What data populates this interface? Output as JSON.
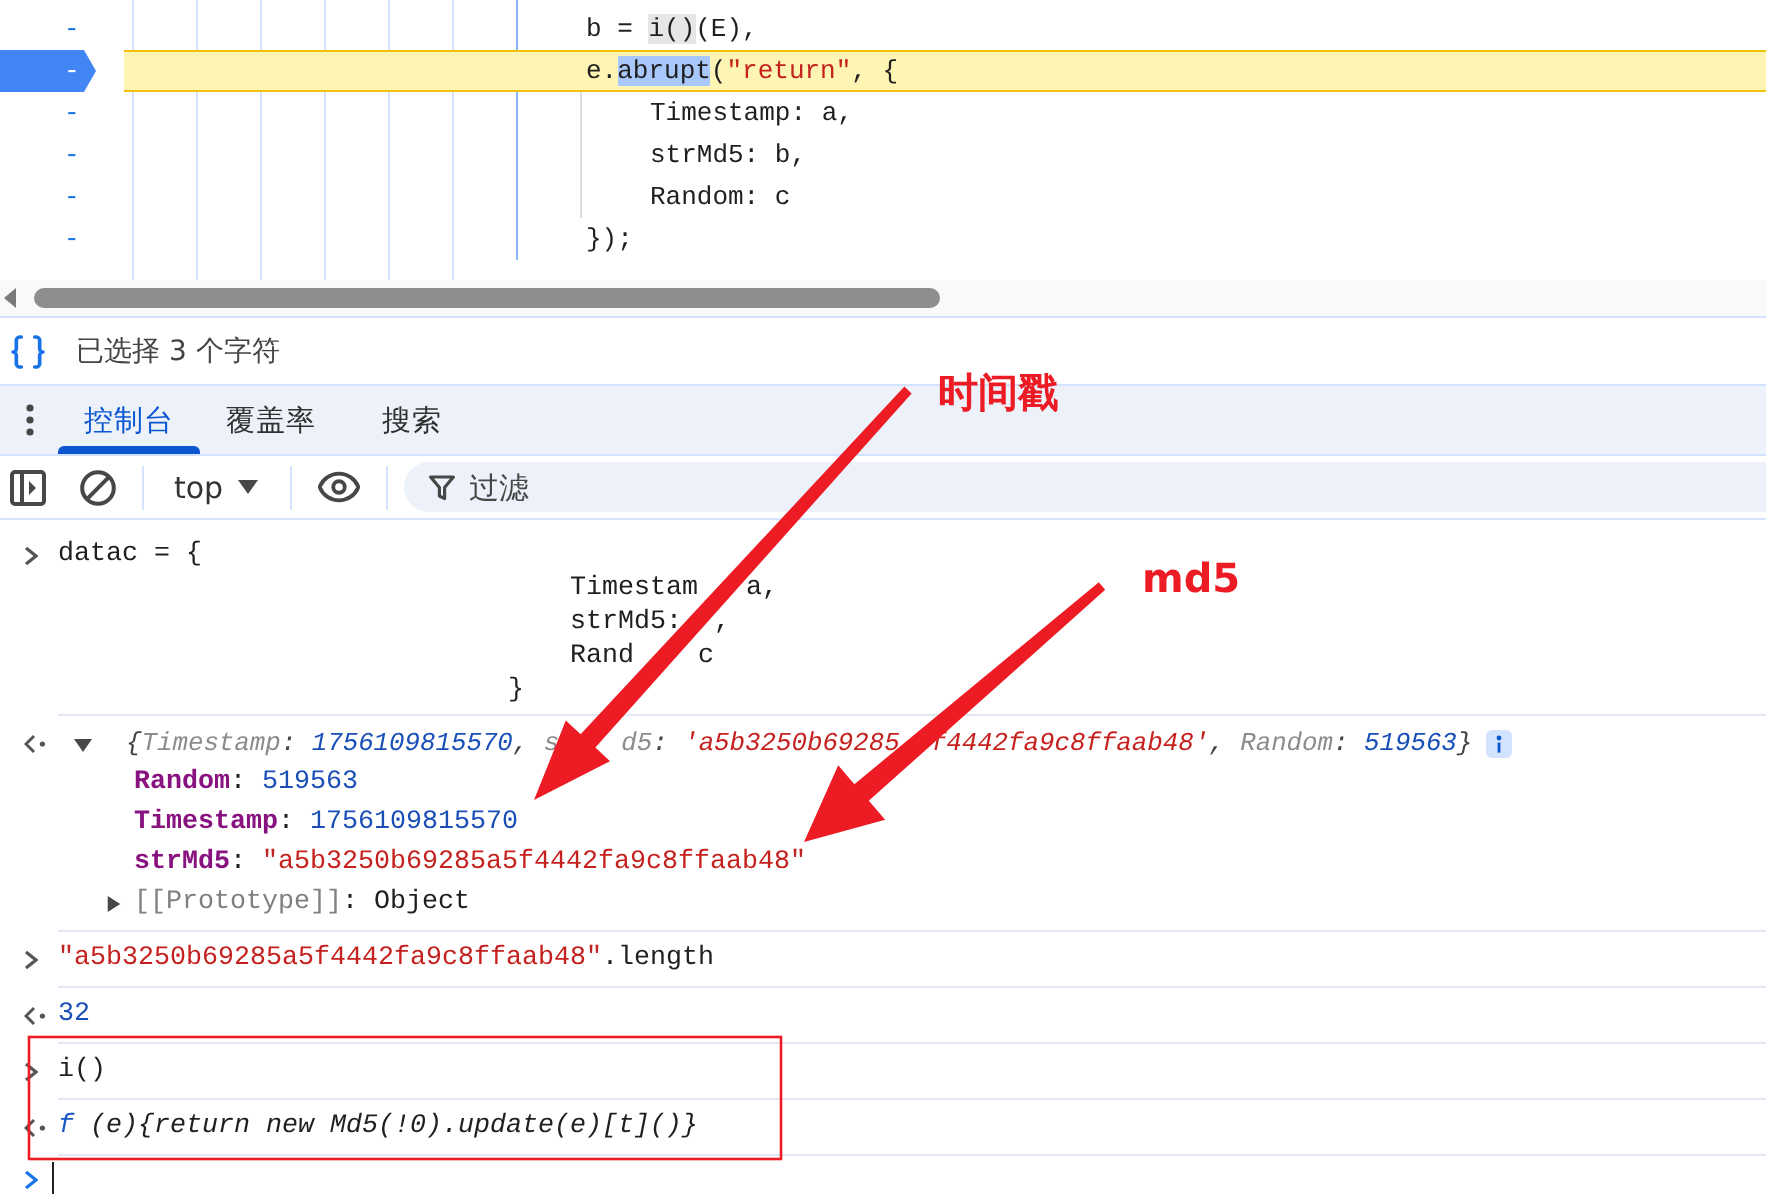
{
  "editor": {
    "lines": [
      {
        "marker": "-",
        "current": false,
        "tokens": [
          {
            "kind": "plain",
            "text": "b = "
          },
          {
            "kind": "match",
            "text": "i()"
          },
          {
            "kind": "plain",
            "text": "(E),"
          }
        ]
      },
      {
        "marker": "-",
        "current": true,
        "tokens": [
          {
            "kind": "plain",
            "text": "e."
          },
          {
            "kind": "selected",
            "text": "abrupt"
          },
          {
            "kind": "plain",
            "text": "("
          },
          {
            "kind": "string",
            "text": "\"return\""
          },
          {
            "kind": "plain",
            "text": ", {"
          }
        ],
        "children": [
          {
            "marker": "-",
            "current": false,
            "tokens": [
              {
                "kind": "plain",
                "text": "Timestamp: a,"
              }
            ]
          },
          {
            "marker": "-",
            "current": false,
            "tokens": [
              {
                "kind": "plain",
                "text": "strMd5: b,"
              }
            ]
          },
          {
            "marker": "-",
            "current": false,
            "tokens": [
              {
                "kind": "plain",
                "text": "Random: c"
              }
            ]
          }
        ]
      },
      {
        "marker": "-",
        "current": false,
        "tokens": [
          {
            "kind": "plain",
            "text": "});"
          }
        ]
      }
    ]
  },
  "status": {
    "selection": "已选择 3 个字符"
  },
  "tabs": [
    {
      "label": "控制台",
      "selected": true
    },
    {
      "label": "覆盖率",
      "selected": false
    },
    {
      "label": "搜索",
      "selected": false
    }
  ],
  "toolbar": {
    "context": "top",
    "filter": {
      "placeholder": "过滤"
    }
  },
  "console": {
    "entries": [
      {
        "kind": "input",
        "tokens": [
          {
            "kind": "plain",
            "text": "datac = {"
          }
        ],
        "body": [
          [
            "Timestam",
            "a,"
          ],
          [
            "strMd5:",
            ","
          ],
          [
            "Rand",
            "c"
          ]
        ],
        "closing": "}"
      },
      {
        "kind": "object",
        "expanded": true,
        "preview": [
          [
            {
              "kind": "punct",
              "text": "{"
            },
            {
              "kind": "key_dim",
              "text": "Timestamp"
            },
            {
              "kind": "punct",
              "text": ": "
            },
            {
              "kind": "number",
              "text": "1756109815570"
            },
            {
              "kind": "punct",
              "text": ", "
            },
            {
              "kind": "key_dim",
              "text": "s"
            }
          ],
          [
            {
              "kind": "key_dim",
              "text": "d5"
            },
            {
              "kind": "punct",
              "text": ": "
            },
            {
              "kind": "string",
              "text": "'a5b3250b69285"
            }
          ],
          [
            {
              "kind": "string",
              "text": "f4442fa9c8ffaab48'"
            },
            {
              "kind": "punct",
              "text": ", "
            },
            {
              "kind": "key_dim",
              "text": "Random"
            },
            {
              "kind": "punct",
              "text": ": "
            },
            {
              "kind": "number",
              "text": "519563"
            },
            {
              "kind": "punct",
              "text": "}"
            }
          ]
        ],
        "properties": [
          {
            "tokens": [
              {
                "kind": "key",
                "text": "Random"
              },
              {
                "kind": "punct",
                "text": ": "
              },
              {
                "kind": "number",
                "text": "519563"
              }
            ]
          },
          {
            "tokens": [
              {
                "kind": "key",
                "text": "Timestamp"
              },
              {
                "kind": "punct",
                "text": ": "
              },
              {
                "kind": "number",
                "text": "1756109815570"
              }
            ]
          },
          {
            "tokens": [
              {
                "kind": "key",
                "text": "strMd5"
              },
              {
                "kind": "punct",
                "text": ": "
              },
              {
                "kind": "string",
                "text": "\"a5b3250b69285a5f4442fa9c8ffaab48\""
              }
            ]
          }
        ],
        "prototype": {
          "expanded": false,
          "tokens": [
            {
              "kind": "proto",
              "text": "[[Prototype]]"
            },
            {
              "kind": "punct",
              "text": ": "
            },
            {
              "kind": "plain",
              "text": "Object"
            }
          ]
        }
      },
      {
        "kind": "input",
        "tokens": [
          {
            "kind": "string",
            "text": "\"a5b3250b69285a5f4442fa9c8ffaab48\""
          },
          {
            "kind": "plain",
            "text": ".length"
          }
        ]
      },
      {
        "kind": "result",
        "tokens": [
          {
            "kind": "number",
            "text": "32"
          }
        ]
      },
      {
        "kind": "input",
        "tokens": [
          {
            "kind": "plain",
            "text": "i()"
          }
        ]
      },
      {
        "kind": "result",
        "tokens": [
          {
            "kind": "fn",
            "text": "f"
          },
          {
            "kind": "italic",
            "text": " (e){return new Md5(!0).update(e)[t]()}"
          }
        ]
      }
    ]
  },
  "annotations": [
    {
      "text": "时间戳"
    },
    {
      "text": "md5"
    }
  ]
}
